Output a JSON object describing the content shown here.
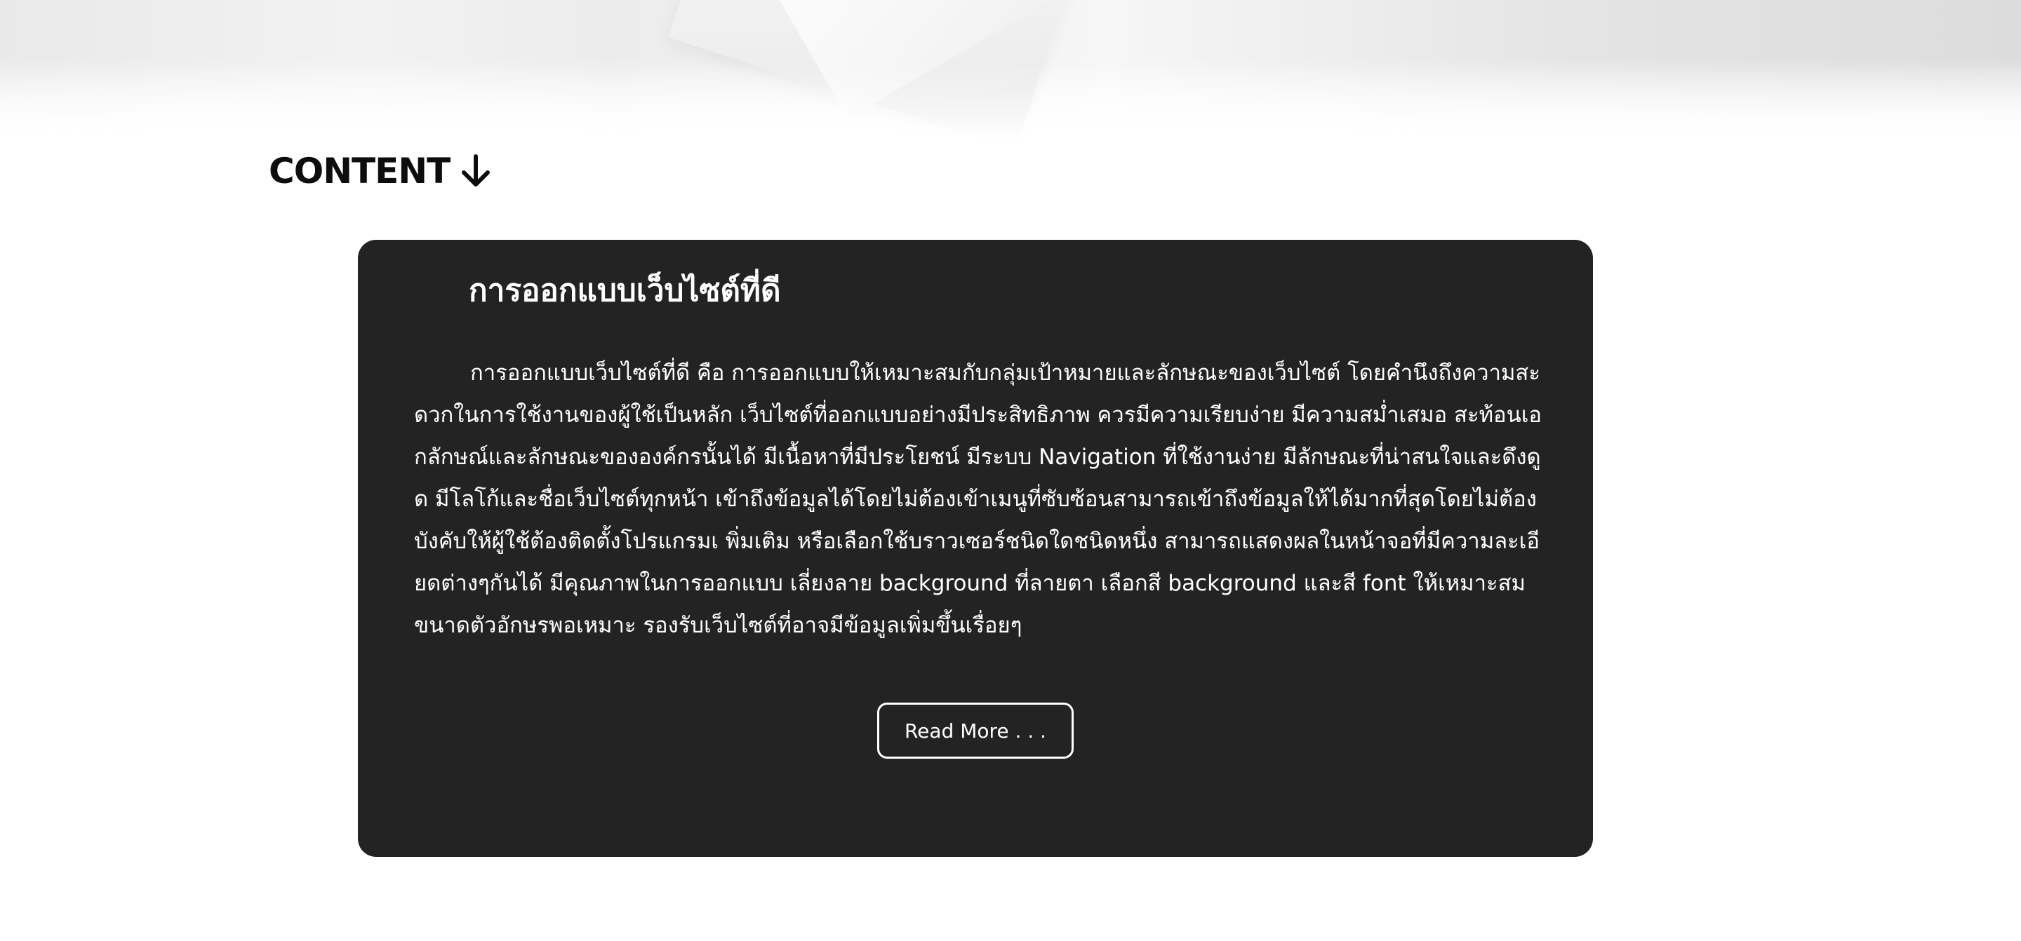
{
  "section": {
    "heading": "CONTENT",
    "heading_icon": "arrow-down-icon"
  },
  "card": {
    "title": "การออกแบบเว็บไซต์ที่ดี",
    "body": "การออกแบบเว็บไซต์ที่ดี คือ การออกแบบให้เหมาะสมกับกลุ่มเป้าหมายและลักษณะของเว็บไซต์ โดยคำนึงถึงความสะดวกในการใช้งานของผู้ใช้เป็นหลัก เว็บไซต์ที่ออกแบบอย่างมีประสิทธิภาพ ควรมีความเรียบง่าย มีความสม่ำเสมอ สะท้อนเอกลักษณ์และลักษณะขององค์กรนั้นได้ มีเนื้อหาที่มีประโยชน์ มีระบบ Navigation ที่ใช้งานง่าย มีลักษณะที่น่าสนใจและดึงดูด มีโลโก้และชื่อเว็บไซต์ทุกหน้า เข้าถึงข้อมูลได้โดยไม่ต้องเข้าเมนูที่ซับซ้อนสามารถเข้าถึงข้อมูลให้ได้มากที่สุดโดยไม่ต้องบังคับให้ผู้ใช้ต้องติดตั้งโปรแกรมเ พิ่มเติม หรือเลือกใช้บราวเซอร์ชนิดใดชนิดหนึ่ง สามารถแสดงผลในหน้าจอที่มีความละเอียดต่างๆกันได้ มีคุณภาพในการออกแบบ เลี่ยงลาย background ที่ลายตา เลือกสี background และสี font ให้เหมาะสม ขนาดตัวอักษรพอเหมาะ รองรับเว็บไซต์ที่อาจมีข้อมูลเพิ่มขึ้นเรื่อยๆ",
    "read_more_label": "Read More . . ."
  },
  "colors": {
    "card_background": "#232323",
    "heading_text": "#0d0d0d",
    "card_text": "#ffffff",
    "page_background": "#ffffff"
  }
}
